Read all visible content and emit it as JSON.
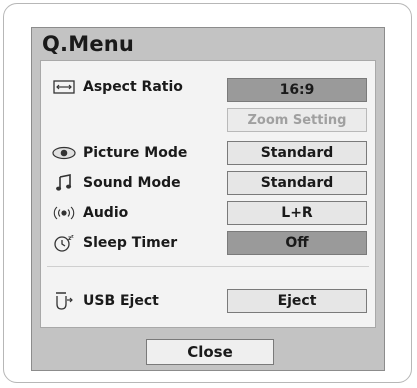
{
  "menu": {
    "title": "Q.Menu",
    "items": [
      {
        "icon": "aspect-ratio-icon",
        "label": "Aspect Ratio",
        "value": "16:9"
      },
      {
        "label": "",
        "value": "Zoom Setting"
      },
      {
        "icon": "eye-icon",
        "label": "Picture Mode",
        "value": "Standard"
      },
      {
        "icon": "music-note-icon",
        "label": "Sound Mode",
        "value": "Standard"
      },
      {
        "icon": "audio-waves-icon",
        "label": "Audio",
        "value": "L+R"
      },
      {
        "icon": "sleep-timer-icon",
        "label": "Sleep Timer",
        "value": "Off"
      },
      {
        "icon": "usb-eject-icon",
        "label": "USB Eject",
        "value": "Eject"
      }
    ],
    "close_label": "Close"
  }
}
